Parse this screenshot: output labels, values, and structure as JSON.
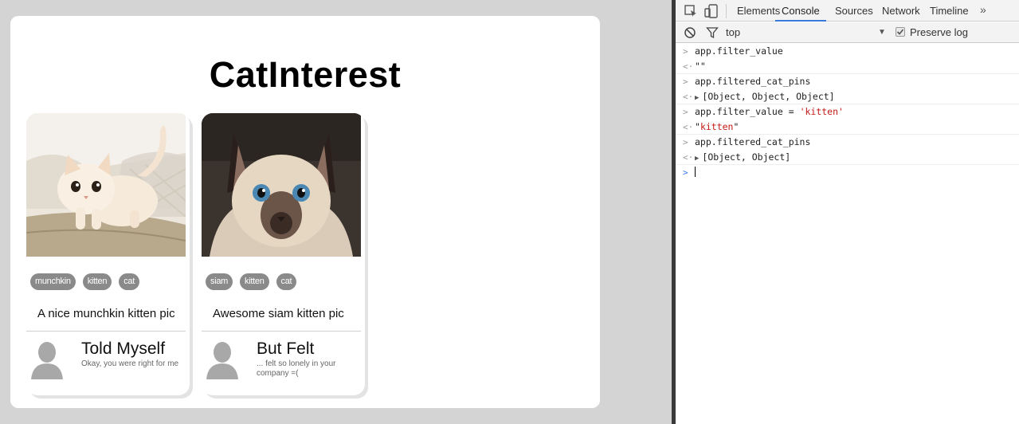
{
  "app": {
    "title": "CatInterest",
    "pins": [
      {
        "tags": [
          "munchkin",
          "kitten",
          "cat"
        ],
        "caption": "A nice munchkin kitten pic",
        "author": "Told Myself",
        "subtitle": "Okay, you were right for me"
      },
      {
        "tags": [
          "siam",
          "kitten",
          "cat"
        ],
        "caption": "Awesome siam kitten pic",
        "author": "But Felt",
        "subtitle": "... felt so lonely in your company =("
      }
    ]
  },
  "devtools": {
    "tabs": [
      "Elements",
      "Console",
      "Sources",
      "Network",
      "Timeline"
    ],
    "active_tab": "Console",
    "more_label": "»",
    "context": "top",
    "preserve_log_label": "Preserve log",
    "preserve_log_checked": true,
    "console": [
      {
        "kind": "in",
        "text": "app.filter_value"
      },
      {
        "kind": "out",
        "text": "\"\""
      },
      {
        "kind": "in",
        "text": "app.filtered_cat_pins"
      },
      {
        "kind": "out",
        "expandable": true,
        "text": "[Object, Object, Object]"
      },
      {
        "kind": "in",
        "text": "app.filter_value = ",
        "string": "'kitten'"
      },
      {
        "kind": "out",
        "text": "\"",
        "string": "kitten",
        "suffix": "\""
      },
      {
        "kind": "in",
        "text": "app.filtered_cat_pins"
      },
      {
        "kind": "out",
        "expandable": true,
        "text": "[Object, Object]"
      }
    ],
    "input_marker": ">",
    "output_marker": "<·"
  }
}
